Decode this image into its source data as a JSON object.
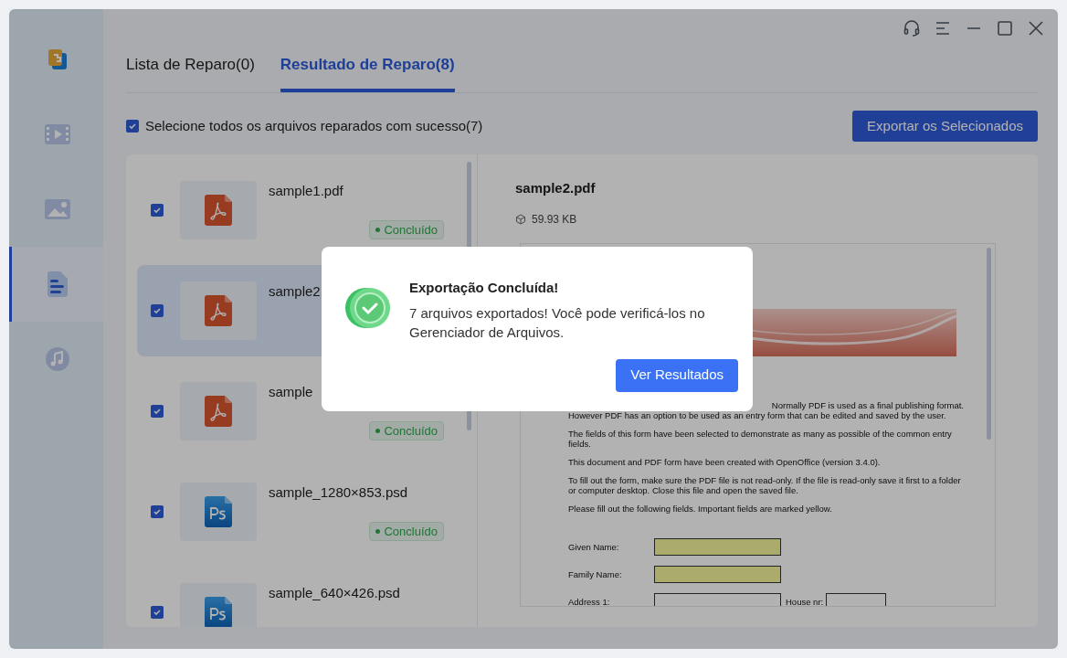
{
  "sidebar": {
    "items": [
      {
        "kind": "logo",
        "selected": false
      },
      {
        "kind": "video",
        "selected": false
      },
      {
        "kind": "image",
        "selected": false
      },
      {
        "kind": "document",
        "selected": true
      },
      {
        "kind": "music",
        "selected": false
      }
    ]
  },
  "tabs": [
    {
      "label": "Lista de Reparo(0)",
      "selected": false
    },
    {
      "label": "Resultado de Reparo(8)",
      "selected": true
    }
  ],
  "select_all": {
    "label": "Selecione todos os arquivos reparados com sucesso(7)",
    "checked": true
  },
  "export_button": "Exportar os Selecionados",
  "files": [
    {
      "name": "sample1.pdf",
      "kind": "pdf",
      "checked": true,
      "selected": false,
      "status": "Concluído"
    },
    {
      "name": "sample2",
      "kind": "pdf",
      "checked": true,
      "selected": true
    },
    {
      "name": "sample",
      "kind": "pdf",
      "checked": true,
      "selected": false,
      "status": "Concluído"
    },
    {
      "name": "sample_1280×853.psd",
      "kind": "psd",
      "checked": true,
      "selected": false,
      "status": "Concluído"
    },
    {
      "name": "sample_640×426.psd",
      "kind": "psd",
      "checked": true,
      "selected": false
    }
  ],
  "preview": {
    "title": "sample2.pdf",
    "size": "59.93 KB",
    "document": {
      "covered_line": "Normally PDF is used as a final publishing format.",
      "paragraphs": [
        "However PDF has an option to be used as an entry form that can be edited and saved by the user.",
        "The fields of this form have been selected to demonstrate as many as possible of the common entry fields.",
        "This document and PDF form have been created with OpenOffice (version 3.4.0).",
        "To fill out the form, make sure the PDF file is not read-only. If the file is read-only save it first to a folder or computer desktop. Close this file and open the saved file.",
        "Please fill out the following fields. Important fields are marked yellow."
      ],
      "form": [
        {
          "label": "Given Name:",
          "highlighted": true
        },
        {
          "label": "Family Name:",
          "highlighted": true
        },
        {
          "label": "Address 1:",
          "highlighted": false,
          "extra_label": "House nr:"
        }
      ]
    }
  },
  "dialog": {
    "title": "Exportação Concluída!",
    "message": "7 arquivos exportados! Você pode verificá-los no Gerenciador de Arquivos.",
    "button": "Ver Resultados"
  }
}
